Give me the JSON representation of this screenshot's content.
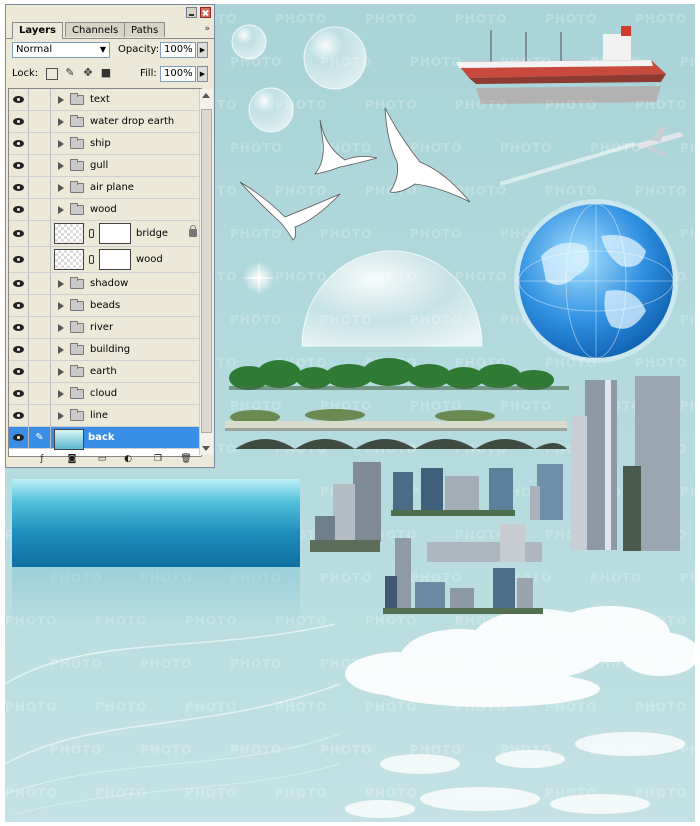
{
  "watermark": "PHOTO",
  "panel": {
    "tabs": [
      {
        "label": "Layers",
        "active": true
      },
      {
        "label": "Channels",
        "active": false
      },
      {
        "label": "Paths",
        "active": false
      }
    ],
    "menu_icon": "double-chevron-right-icon",
    "blend_mode": "Normal",
    "opacity_label": "Opacity:",
    "opacity_value": "100%",
    "lock_label": "Lock:",
    "fill_label": "Fill:",
    "fill_value": "100%",
    "layers": [
      {
        "name": "text",
        "type": "group"
      },
      {
        "name": "water drop earth",
        "type": "group"
      },
      {
        "name": "ship",
        "type": "group"
      },
      {
        "name": "gull",
        "type": "group"
      },
      {
        "name": "air plane",
        "type": "group"
      },
      {
        "name": "wood",
        "type": "group"
      },
      {
        "name": "bridge",
        "type": "masked",
        "locked": true
      },
      {
        "name": "wood",
        "type": "masked"
      },
      {
        "name": "shadow",
        "type": "group"
      },
      {
        "name": "beads",
        "type": "group"
      },
      {
        "name": "river",
        "type": "group"
      },
      {
        "name": "building",
        "type": "group"
      },
      {
        "name": "earth",
        "type": "group"
      },
      {
        "name": "cloud",
        "type": "group"
      },
      {
        "name": "line",
        "type": "group"
      },
      {
        "name": "back",
        "type": "layer",
        "selected": true
      }
    ],
    "bottom_icons": [
      "fx-icon",
      "mask-icon",
      "folder-icon",
      "adjustment-icon",
      "new-layer-icon",
      "trash-icon"
    ]
  },
  "colors": {
    "canvas": "#b2d9dd",
    "selected_row": "#3a8ee6",
    "water": "#1f8fbf",
    "globe": "#2f8fe0"
  }
}
